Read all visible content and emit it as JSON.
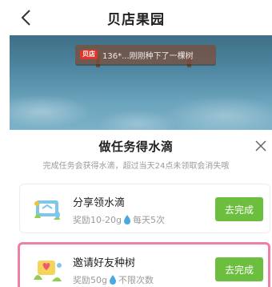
{
  "header": {
    "title": "贝店果园"
  },
  "scene": {
    "ticker_badge": "贝店",
    "ticker_text": "136*...刚刚种下了一棵树"
  },
  "task_panel": {
    "title": "做任务得水滴",
    "subtitle": "完成任务会获得水滴，超过当天24点未领取会消失哦",
    "tasks": [
      {
        "name": "分享领水滴",
        "reward_prefix": "奖励10-20g",
        "reward_suffix": "每天5次",
        "button": "去完成"
      },
      {
        "name": "邀请好友种树",
        "reward_prefix": "奖励50g",
        "reward_suffix": "不限次数",
        "button": "去完成"
      }
    ]
  },
  "colors": {
    "button_green": "#6cbf3e",
    "highlight_pink": "#ef7fa9",
    "ticker_badge_red": "#e0352b"
  }
}
